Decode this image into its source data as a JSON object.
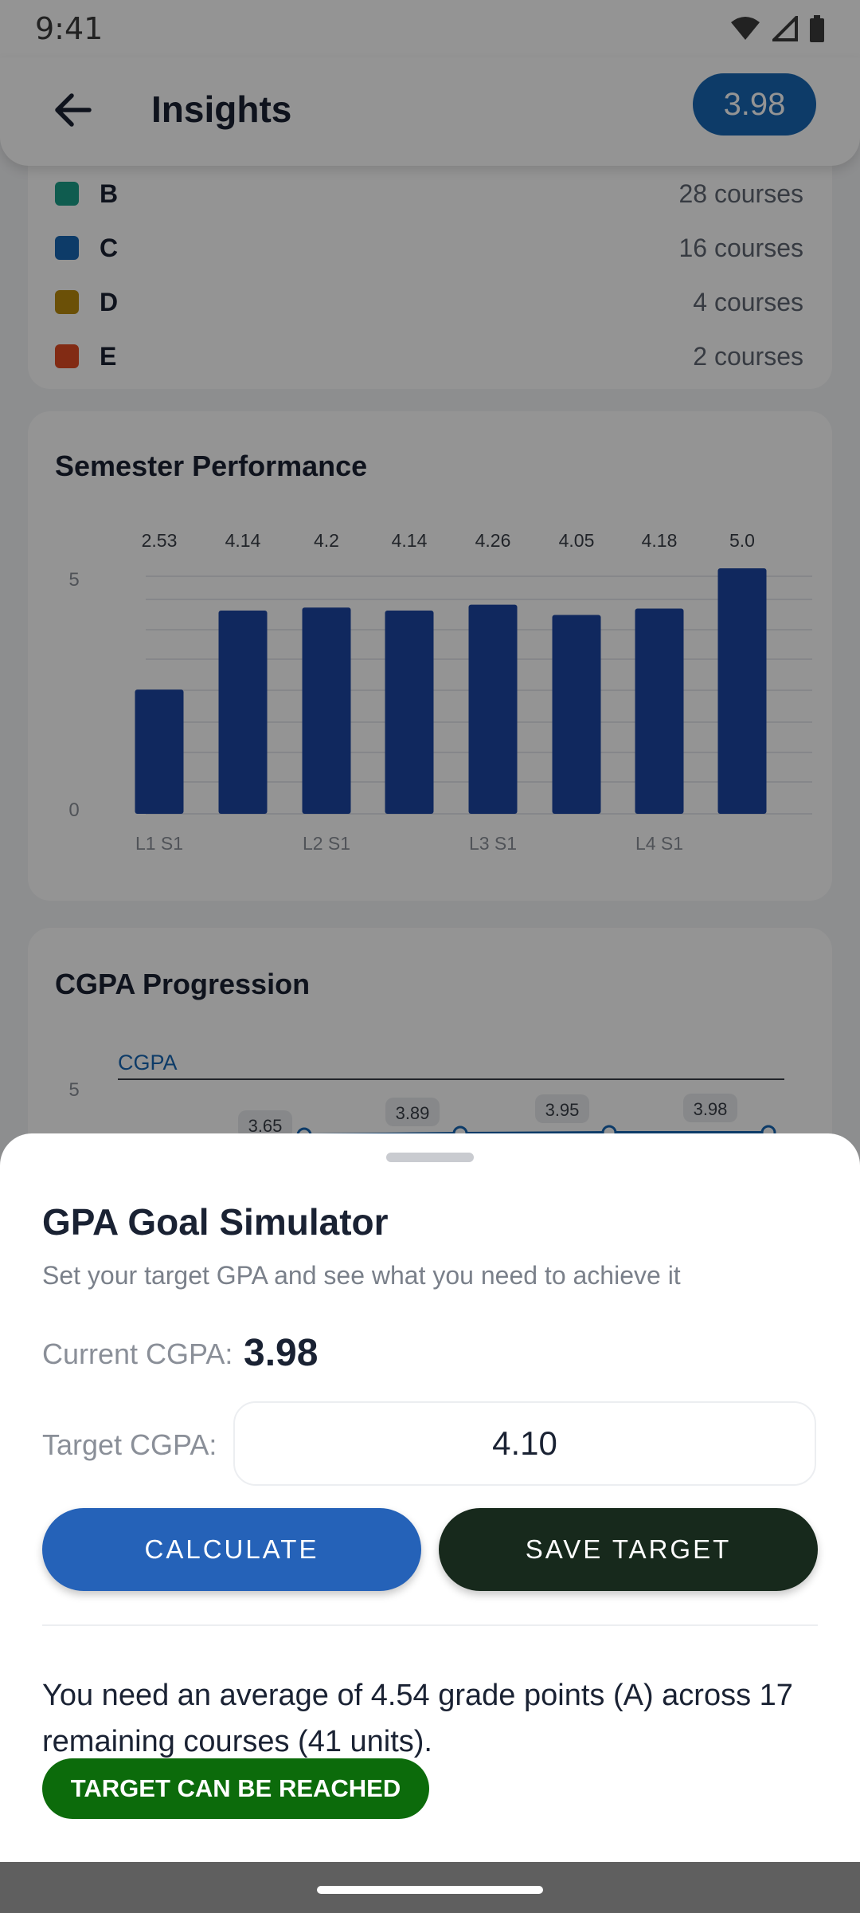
{
  "status_bar": {
    "time": "9:41"
  },
  "app_bar": {
    "title": "Insights",
    "gpa_badge": "3.98"
  },
  "grade_distribution": {
    "rows": [
      {
        "grade": "B",
        "count": "28 courses",
        "color": "#1a9f88"
      },
      {
        "grade": "C",
        "count": "16 courses",
        "color": "#1767b3"
      },
      {
        "grade": "D",
        "count": "4 courses",
        "color": "#b88a0d"
      },
      {
        "grade": "E",
        "count": "2 courses",
        "color": "#e04a24"
      }
    ]
  },
  "semester_performance": {
    "title": "Semester Performance"
  },
  "cgpa_progression": {
    "title": "CGPA Progression"
  },
  "chart_data": [
    {
      "type": "bar",
      "title": "Semester Performance",
      "categories": [
        "L1 S1",
        "",
        "L2 S1",
        "",
        "L3 S1",
        "",
        "L4 S1",
        ""
      ],
      "values": [
        2.53,
        4.14,
        4.2,
        4.14,
        4.26,
        4.05,
        4.18,
        5.0
      ],
      "data_labels": [
        "2.53",
        "4.14",
        "4.2",
        "4.14",
        "4.26",
        "4.05",
        "4.18",
        "5.0"
      ],
      "ylim": [
        0,
        5
      ],
      "yticks": [
        "0",
        "5"
      ],
      "bar_color": "#1c46a3",
      "grid": true
    },
    {
      "type": "line",
      "title": "CGPA Progression",
      "series": [
        {
          "name": "CGPA",
          "values": [
            3.65,
            3.89,
            3.95,
            3.98
          ],
          "labels": [
            "3.65",
            "3.89",
            "3.95",
            "3.98"
          ]
        }
      ],
      "yticks": [
        "5"
      ],
      "line_color": "#1767b3"
    }
  ],
  "sheet": {
    "title": "GPA Goal Simulator",
    "subtitle": "Set your target GPA and see what you need to achieve it",
    "current_label": "Current CGPA:",
    "current_value": "3.98",
    "target_label": "Target CGPA:",
    "target_value": "4.10",
    "calculate_label": "CALCULATE",
    "save_label": "SAVE TARGET",
    "result_text": "You need an average of 4.54 grade points (A) across 17 remaining courses (41 units).",
    "badge_text": "TARGET CAN BE REACHED",
    "colors": {
      "calculate": "#2562b8",
      "save": "#17291c",
      "badge": "#0c6b0b"
    }
  }
}
